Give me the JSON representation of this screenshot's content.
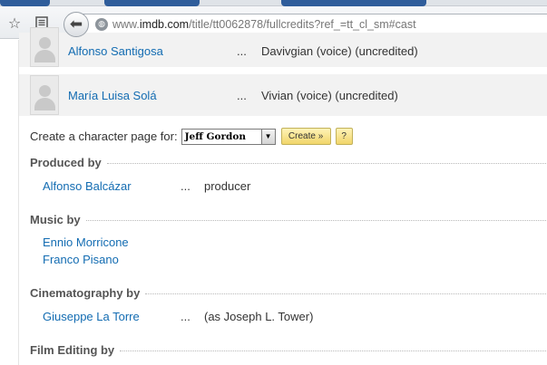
{
  "browser": {
    "url_prefix": "www.",
    "url_host": "imdb.com",
    "url_path": "/title/tt0062878/fullcredits?ref_=tt_cl_sm#cast",
    "icons": [
      "star-icon",
      "reader-icon",
      "back-arrow-icon",
      "globe-icon"
    ]
  },
  "cast": [
    {
      "actor": "Alfonso Santigosa",
      "dots": "...",
      "character": "Davivgian (voice) (uncredited)"
    },
    {
      "actor": "María Luisa Solá",
      "dots": "...",
      "character": "Vivian (voice) (uncredited)"
    }
  ],
  "character_page": {
    "label": "Create a character page for:",
    "selected": "Jeff Gordon",
    "create_label": "Create »",
    "help_label": "?"
  },
  "sections": {
    "produced_by": {
      "title": "Produced by",
      "credits": [
        {
          "name": "Alfonso Balcázar",
          "dots": "...",
          "role": "producer"
        }
      ]
    },
    "music_by": {
      "title": "Music by",
      "credits": [
        {
          "name": "Ennio Morricone"
        },
        {
          "name": "Franco Pisano"
        }
      ]
    },
    "cinematography_by": {
      "title": "Cinematography by",
      "credits": [
        {
          "name": "Giuseppe La Torre",
          "dots": "...",
          "role": "(as Joseph L. Tower)"
        }
      ]
    },
    "film_editing_by": {
      "title": "Film Editing by"
    }
  },
  "colors": {
    "link": "#136cb2",
    "row_background": "#f2f2f2",
    "button_yellow": "#f1d56a",
    "tab_blue": "#2f5d9b"
  }
}
